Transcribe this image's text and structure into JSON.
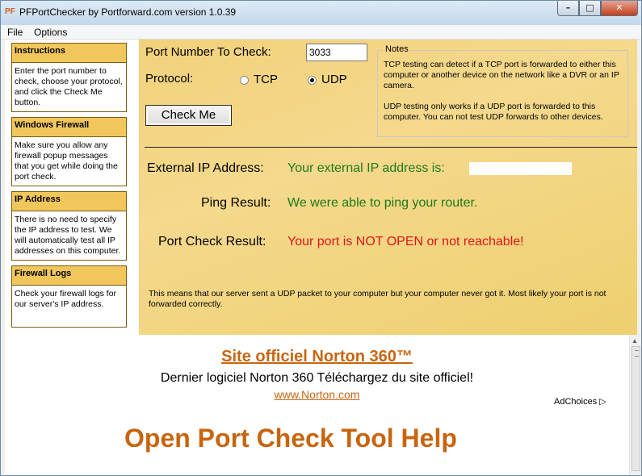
{
  "window": {
    "title": "PFPortChecker by Portforward.com version 1.0.39",
    "controls": {
      "minimize": "–",
      "maximize": "□",
      "close": "✕"
    }
  },
  "menu": [
    "File",
    "Options"
  ],
  "sidebar": [
    {
      "heading": "Instructions",
      "body": "Enter the port number to check, choose your protocol, and click the Check Me button."
    },
    {
      "heading": "Windows Firewall",
      "body": "Make sure you allow any firewall popup messages that you get while doing the port check."
    },
    {
      "heading": "IP Address",
      "body": "There is no need to specify the IP address to test. We will automatically test all IP addresses on this computer."
    },
    {
      "heading": "Firewall Logs",
      "body": "Check your firewall logs for our server's IP address."
    }
  ],
  "form": {
    "port_label": "Port Number To Check:",
    "port_value": "3033",
    "protocol_label": "Protocol:",
    "tcp_label": "TCP",
    "udp_label": "UDP",
    "selected_protocol": "UDP",
    "check_button": "Check Me"
  },
  "notes": {
    "legend": "Notes",
    "tcp_note": "TCP testing can detect if a TCP port is forwarded to either this computer or another device on the network like a DVR or an IP camera.",
    "udp_note": "UDP testing only works if a UDP port is forwarded to this computer. You can not test UDP forwards to other devices."
  },
  "results": {
    "external_ip_label": "External IP Address:",
    "external_ip_text": "Your external IP address is:",
    "ping_label": "Ping Result:",
    "ping_text": "We were able to ping your router.",
    "port_label": "Port Check Result:",
    "port_text": "Your port is NOT OPEN or not reachable!",
    "explanation": "This means that our server sent a UDP packet to your computer but your computer never got it. Most likely your port is not forwarded correctly."
  },
  "browser": {
    "ad_title": "Site officiel Norton 360™",
    "ad_description": "Dernier logiciel Norton 360 Téléchargez du site officiel!",
    "ad_url": "www.Norton.com",
    "adchoices": "AdChoices",
    "help_title": "Open Port Check Tool Help"
  },
  "colors": {
    "accent_orange": "#c8650f",
    "result_green": "#1d7a1d",
    "result_red": "#e0141e",
    "panel_yellow": "#f1c75b"
  }
}
